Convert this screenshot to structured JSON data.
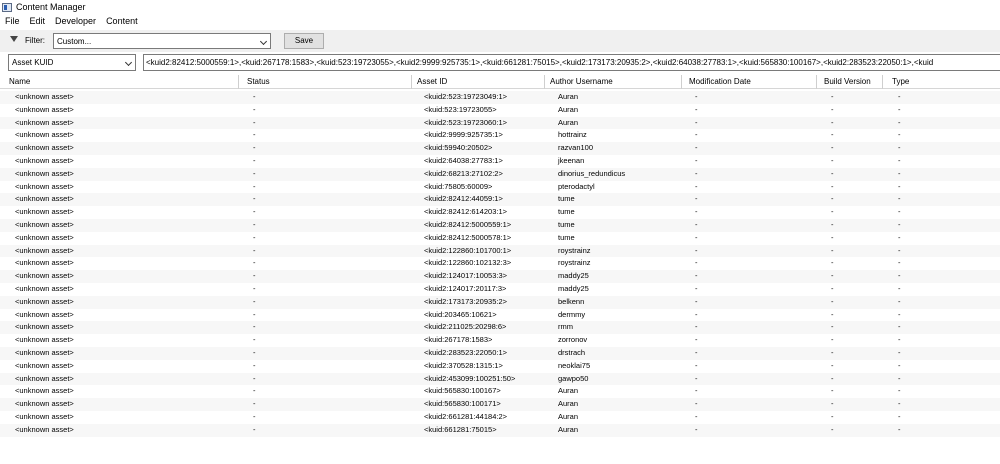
{
  "window": {
    "title": "Content Manager"
  },
  "menu": [
    "File",
    "Edit",
    "Developer",
    "Content"
  ],
  "toolbar": {
    "filter_label": "Filter:",
    "filter_value": "Custom...",
    "save_label": "Save"
  },
  "search": {
    "field_value": "Asset KUID",
    "query": "<kuid2:82412:5000559:1>,<kuid:267178:1583>,<kuid:523:19723055>,<kuid2:9999:925735:1>,<kuid:661281:75015>,<kuid2:173173:20935:2>,<kuid2:64038:27783:1>,<kuid:565830:100167>,<kuid2:283523:22050:1>,<kuid"
  },
  "columns": [
    "Name",
    "Status",
    "Asset ID",
    "Author Username",
    "Modification Date",
    "Build Version",
    "Type"
  ],
  "rows": [
    {
      "name": "<unknown asset>",
      "status": "-",
      "id": "<kuid2:523:19723049:1>",
      "author": "Auran",
      "mod": "-",
      "build": "-",
      "type": "-"
    },
    {
      "name": "<unknown asset>",
      "status": "-",
      "id": "<kuid:523:19723055>",
      "author": "Auran",
      "mod": "-",
      "build": "-",
      "type": "-"
    },
    {
      "name": "<unknown asset>",
      "status": "-",
      "id": "<kuid2:523:19723060:1>",
      "author": "Auran",
      "mod": "-",
      "build": "-",
      "type": "-"
    },
    {
      "name": "<unknown asset>",
      "status": "-",
      "id": "<kuid2:9999:925735:1>",
      "author": "hottrainz",
      "mod": "-",
      "build": "-",
      "type": "-"
    },
    {
      "name": "<unknown asset>",
      "status": "-",
      "id": "<kuid:59940:20502>",
      "author": "razvan100",
      "mod": "-",
      "build": "-",
      "type": "-"
    },
    {
      "name": "<unknown asset>",
      "status": "-",
      "id": "<kuid2:64038:27783:1>",
      "author": "jkeenan",
      "mod": "-",
      "build": "-",
      "type": "-"
    },
    {
      "name": "<unknown asset>",
      "status": "-",
      "id": "<kuid2:68213:27102:2>",
      "author": "dinorius_redundicus",
      "mod": "-",
      "build": "-",
      "type": "-"
    },
    {
      "name": "<unknown asset>",
      "status": "-",
      "id": "<kuid:75805:60009>",
      "author": "pterodactyl",
      "mod": "-",
      "build": "-",
      "type": "-"
    },
    {
      "name": "<unknown asset>",
      "status": "-",
      "id": "<kuid2:82412:44059:1>",
      "author": "tume",
      "mod": "-",
      "build": "-",
      "type": "-"
    },
    {
      "name": "<unknown asset>",
      "status": "-",
      "id": "<kuid2:82412:614203:1>",
      "author": "tume",
      "mod": "-",
      "build": "-",
      "type": "-"
    },
    {
      "name": "<unknown asset>",
      "status": "-",
      "id": "<kuid2:82412:5000559:1>",
      "author": "tume",
      "mod": "-",
      "build": "-",
      "type": "-"
    },
    {
      "name": "<unknown asset>",
      "status": "-",
      "id": "<kuid2:82412:5000578:1>",
      "author": "tume",
      "mod": "-",
      "build": "-",
      "type": "-"
    },
    {
      "name": "<unknown asset>",
      "status": "-",
      "id": "<kuid2:122860:101700:1>",
      "author": "roystrainz",
      "mod": "-",
      "build": "-",
      "type": "-"
    },
    {
      "name": "<unknown asset>",
      "status": "-",
      "id": "<kuid2:122860:102132:3>",
      "author": "roystrainz",
      "mod": "-",
      "build": "-",
      "type": "-"
    },
    {
      "name": "<unknown asset>",
      "status": "-",
      "id": "<kuid2:124017:10053:3>",
      "author": "maddy25",
      "mod": "-",
      "build": "-",
      "type": "-"
    },
    {
      "name": "<unknown asset>",
      "status": "-",
      "id": "<kuid2:124017:20117:3>",
      "author": "maddy25",
      "mod": "-",
      "build": "-",
      "type": "-"
    },
    {
      "name": "<unknown asset>",
      "status": "-",
      "id": "<kuid2:173173:20935:2>",
      "author": "belkenn",
      "mod": "-",
      "build": "-",
      "type": "-"
    },
    {
      "name": "<unknown asset>",
      "status": "-",
      "id": "<kuid:203465:10621>",
      "author": "dermmy",
      "mod": "-",
      "build": "-",
      "type": "-"
    },
    {
      "name": "<unknown asset>",
      "status": "-",
      "id": "<kuid2:211025:20298:6>",
      "author": "rmm",
      "mod": "-",
      "build": "-",
      "type": "-"
    },
    {
      "name": "<unknown asset>",
      "status": "-",
      "id": "<kuid:267178:1583>",
      "author": "zorronov",
      "mod": "-",
      "build": "-",
      "type": "-"
    },
    {
      "name": "<unknown asset>",
      "status": "-",
      "id": "<kuid2:283523:22050:1>",
      "author": "drstrach",
      "mod": "-",
      "build": "-",
      "type": "-"
    },
    {
      "name": "<unknown asset>",
      "status": "-",
      "id": "<kuid2:370528:1315:1>",
      "author": "neoklai75",
      "mod": "-",
      "build": "-",
      "type": "-"
    },
    {
      "name": "<unknown asset>",
      "status": "-",
      "id": "<kuid2:453099:100251:50>",
      "author": "gawpo50",
      "mod": "-",
      "build": "-",
      "type": "-"
    },
    {
      "name": "<unknown asset>",
      "status": "-",
      "id": "<kuid:565830:100167>",
      "author": "Auran",
      "mod": "-",
      "build": "-",
      "type": "-"
    },
    {
      "name": "<unknown asset>",
      "status": "-",
      "id": "<kuid:565830:100171>",
      "author": "Auran",
      "mod": "-",
      "build": "-",
      "type": "-"
    },
    {
      "name": "<unknown asset>",
      "status": "-",
      "id": "<kuid2:661281:44184:2>",
      "author": "Auran",
      "mod": "-",
      "build": "-",
      "type": "-"
    },
    {
      "name": "<unknown asset>",
      "status": "-",
      "id": "<kuid:661281:75015>",
      "author": "Auran",
      "mod": "-",
      "build": "-",
      "type": "-"
    }
  ]
}
